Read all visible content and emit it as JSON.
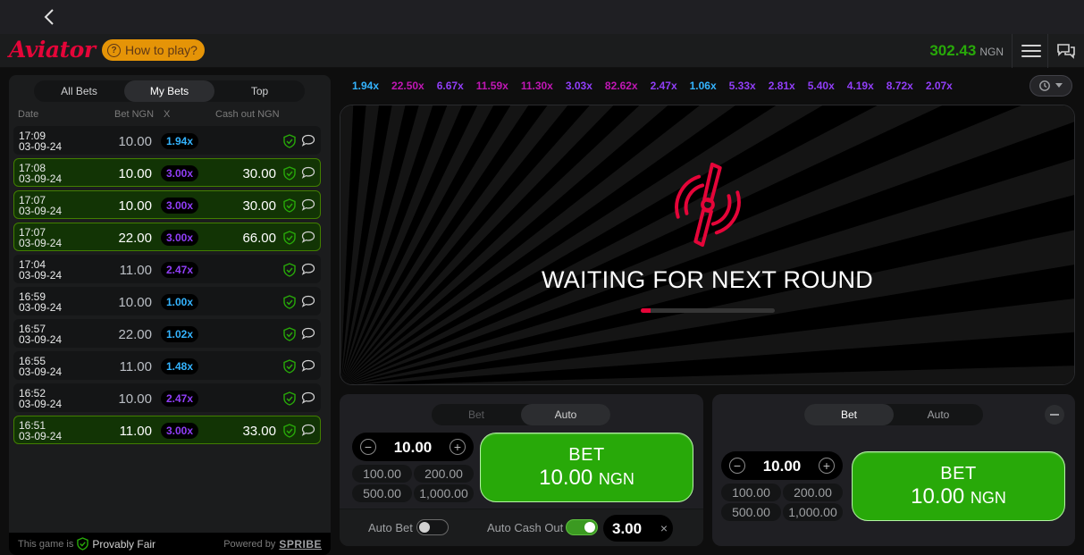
{
  "header": {
    "logo": "Aviator",
    "how_to_play": "How to play?",
    "balance_amount": "302.43",
    "balance_currency": "NGN"
  },
  "bets_panel": {
    "tabs": [
      "All Bets",
      "My Bets",
      "Top"
    ],
    "active_tab": "My Bets",
    "columns": {
      "date": "Date",
      "bet": "Bet NGN",
      "mult": "X",
      "cashout": "Cash out NGN"
    },
    "rows": [
      {
        "time": "17:09",
        "date": "03-09-24",
        "bet": "10.00",
        "mult": "1.94x",
        "cashout": "",
        "win": false,
        "mult_color": "#34b4ff"
      },
      {
        "time": "17:08",
        "date": "03-09-24",
        "bet": "10.00",
        "mult": "3.00x",
        "cashout": "30.00",
        "win": true,
        "mult_color": "#913ef8"
      },
      {
        "time": "17:07",
        "date": "03-09-24",
        "bet": "10.00",
        "mult": "3.00x",
        "cashout": "30.00",
        "win": true,
        "mult_color": "#913ef8"
      },
      {
        "time": "17:07",
        "date": "03-09-24",
        "bet": "22.00",
        "mult": "3.00x",
        "cashout": "66.00",
        "win": true,
        "mult_color": "#913ef8"
      },
      {
        "time": "17:04",
        "date": "03-09-24",
        "bet": "11.00",
        "mult": "2.47x",
        "cashout": "",
        "win": false,
        "mult_color": "#913ef8"
      },
      {
        "time": "16:59",
        "date": "03-09-24",
        "bet": "10.00",
        "mult": "1.00x",
        "cashout": "",
        "win": false,
        "mult_color": "#34b4ff"
      },
      {
        "time": "16:57",
        "date": "03-09-24",
        "bet": "22.00",
        "mult": "1.02x",
        "cashout": "",
        "win": false,
        "mult_color": "#34b4ff"
      },
      {
        "time": "16:55",
        "date": "03-09-24",
        "bet": "11.00",
        "mult": "1.48x",
        "cashout": "",
        "win": false,
        "mult_color": "#34b4ff"
      },
      {
        "time": "16:52",
        "date": "03-09-24",
        "bet": "10.00",
        "mult": "2.47x",
        "cashout": "",
        "win": false,
        "mult_color": "#913ef8"
      },
      {
        "time": "16:51",
        "date": "03-09-24",
        "bet": "11.00",
        "mult": "3.00x",
        "cashout": "33.00",
        "win": true,
        "mult_color": "#913ef8"
      }
    ],
    "footer": {
      "this_game_is": "This game is",
      "provably_fair": "Provably Fair",
      "powered_by": "Powered by",
      "brand": "SPRIBE"
    }
  },
  "history": [
    {
      "v": "1.94x",
      "c": "#34b4ff"
    },
    {
      "v": "22.50x",
      "c": "#c017b4"
    },
    {
      "v": "6.67x",
      "c": "#913ef8"
    },
    {
      "v": "11.59x",
      "c": "#c017b4"
    },
    {
      "v": "11.30x",
      "c": "#c017b4"
    },
    {
      "v": "3.03x",
      "c": "#913ef8"
    },
    {
      "v": "82.62x",
      "c": "#c017b4"
    },
    {
      "v": "2.47x",
      "c": "#913ef8"
    },
    {
      "v": "1.06x",
      "c": "#34b4ff"
    },
    {
      "v": "5.33x",
      "c": "#913ef8"
    },
    {
      "v": "2.81x",
      "c": "#913ef8"
    },
    {
      "v": "5.40x",
      "c": "#913ef8"
    },
    {
      "v": "4.19x",
      "c": "#913ef8"
    },
    {
      "v": "8.72x",
      "c": "#913ef8"
    },
    {
      "v": "2.07x",
      "c": "#913ef8"
    }
  ],
  "stage": {
    "status": "WAITING FOR NEXT ROUND",
    "progress": 0.07
  },
  "bet1": {
    "tabs": [
      "Bet",
      "Auto"
    ],
    "active_tab": "Auto",
    "amount": "10.00",
    "quick": [
      "100.00",
      "200.00",
      "500.00",
      "1,000.00"
    ],
    "button_title": "BET",
    "button_amount": "10.00",
    "button_currency": "NGN",
    "auto_bet_label": "Auto Bet",
    "auto_bet_on": false,
    "auto_cashout_label": "Auto Cash Out",
    "auto_cashout_on": true,
    "auto_cashout_value": "3.00",
    "clear": "×"
  },
  "bet2": {
    "tabs": [
      "Bet",
      "Auto"
    ],
    "active_tab": "Bet",
    "amount": "10.00",
    "quick": [
      "100.00",
      "200.00",
      "500.00",
      "1,000.00"
    ],
    "button_title": "BET",
    "button_amount": "10.00",
    "button_currency": "NGN"
  }
}
